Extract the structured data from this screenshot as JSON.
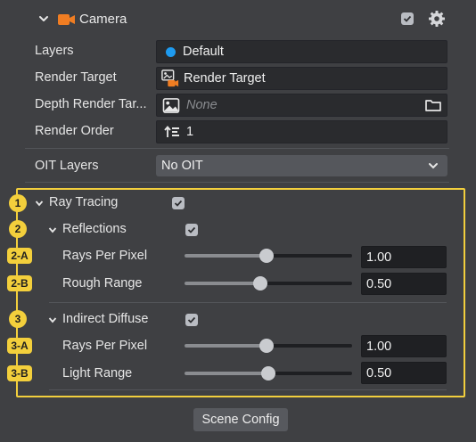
{
  "header": {
    "title": "Camera",
    "enabled": true,
    "accent": "#f07d22"
  },
  "fields": {
    "layers": {
      "label": "Layers",
      "value": "Default",
      "dot_color": "#1e9bf0"
    },
    "render_target": {
      "label": "Render Target",
      "value": "Render Target"
    },
    "depth_render_target": {
      "label": "Depth Render Tar...",
      "value": "None"
    },
    "render_order": {
      "label": "Render Order",
      "value": "1"
    },
    "oit_layers": {
      "label": "OIT Layers",
      "value": "No OIT"
    }
  },
  "ray_tracing": {
    "badge": "1",
    "label": "Ray Tracing",
    "enabled": true,
    "reflections": {
      "badge": "2",
      "label": "Reflections",
      "enabled": true,
      "rays_per_pixel": {
        "badge": "2-A",
        "label": "Rays Per Pixel",
        "value": "1.00",
        "level": 0.49
      },
      "rough_range": {
        "badge": "2-B",
        "label": "Rough Range",
        "value": "0.50",
        "level": 0.45
      }
    },
    "indirect_diffuse": {
      "badge": "3",
      "label": "Indirect Diffuse",
      "enabled": true,
      "rays_per_pixel": {
        "badge": "3-A",
        "label": "Rays Per Pixel",
        "value": "1.00",
        "level": 0.49
      },
      "light_range": {
        "badge": "3-B",
        "label": "Light Range",
        "value": "0.50",
        "level": 0.5
      }
    }
  },
  "footer": {
    "scene_config_label": "Scene Config"
  },
  "colors": {
    "highlight": "#f2cf3d",
    "background": "#3f4043"
  }
}
